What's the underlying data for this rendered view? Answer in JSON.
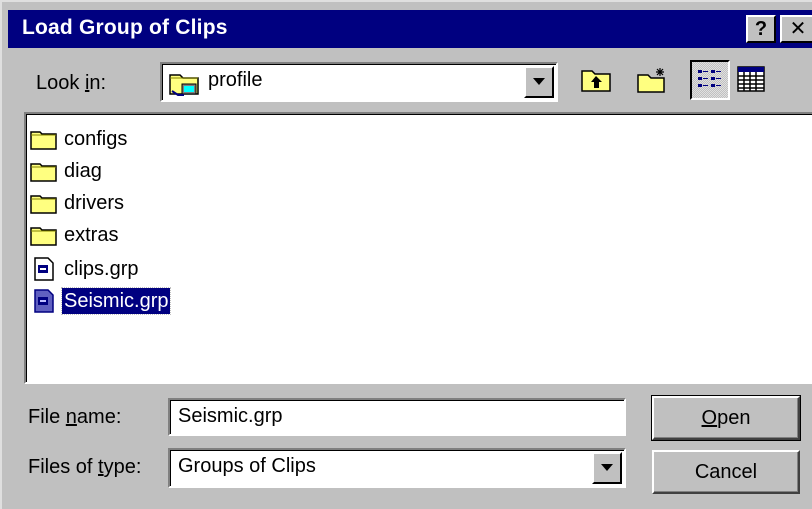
{
  "window": {
    "title": "Load Group of Clips",
    "help_button": "?",
    "close_button": "✕"
  },
  "lookin": {
    "label_prefix": "Look ",
    "label_mnemonic": "i",
    "label_suffix": "n:",
    "value": "profile"
  },
  "toolbar": {
    "icons": [
      "up-one-level-icon",
      "create-new-folder-icon",
      "list-view-icon",
      "details-view-icon"
    ],
    "active_view": "list"
  },
  "files": [
    {
      "name": "configs",
      "type": "folder"
    },
    {
      "name": "diag",
      "type": "folder"
    },
    {
      "name": "drivers",
      "type": "folder"
    },
    {
      "name": "extras",
      "type": "folder"
    },
    {
      "name": "clips.grp",
      "type": "file"
    },
    {
      "name": "Seismic.grp",
      "type": "file",
      "selected": true
    }
  ],
  "filename": {
    "label_prefix": "File ",
    "label_mnemonic": "n",
    "label_suffix": "ame:",
    "value": "Seismic.grp"
  },
  "filetype": {
    "label_prefix": "Files of ",
    "label_mnemonic": "t",
    "label_suffix": "ype:",
    "value": "Groups of Clips"
  },
  "buttons": {
    "open_mnemonic": "O",
    "open_rest": "pen",
    "cancel": "Cancel"
  },
  "colors": {
    "titlebar": "#000080",
    "face": "#c0c0c0",
    "selection": "#000080"
  }
}
